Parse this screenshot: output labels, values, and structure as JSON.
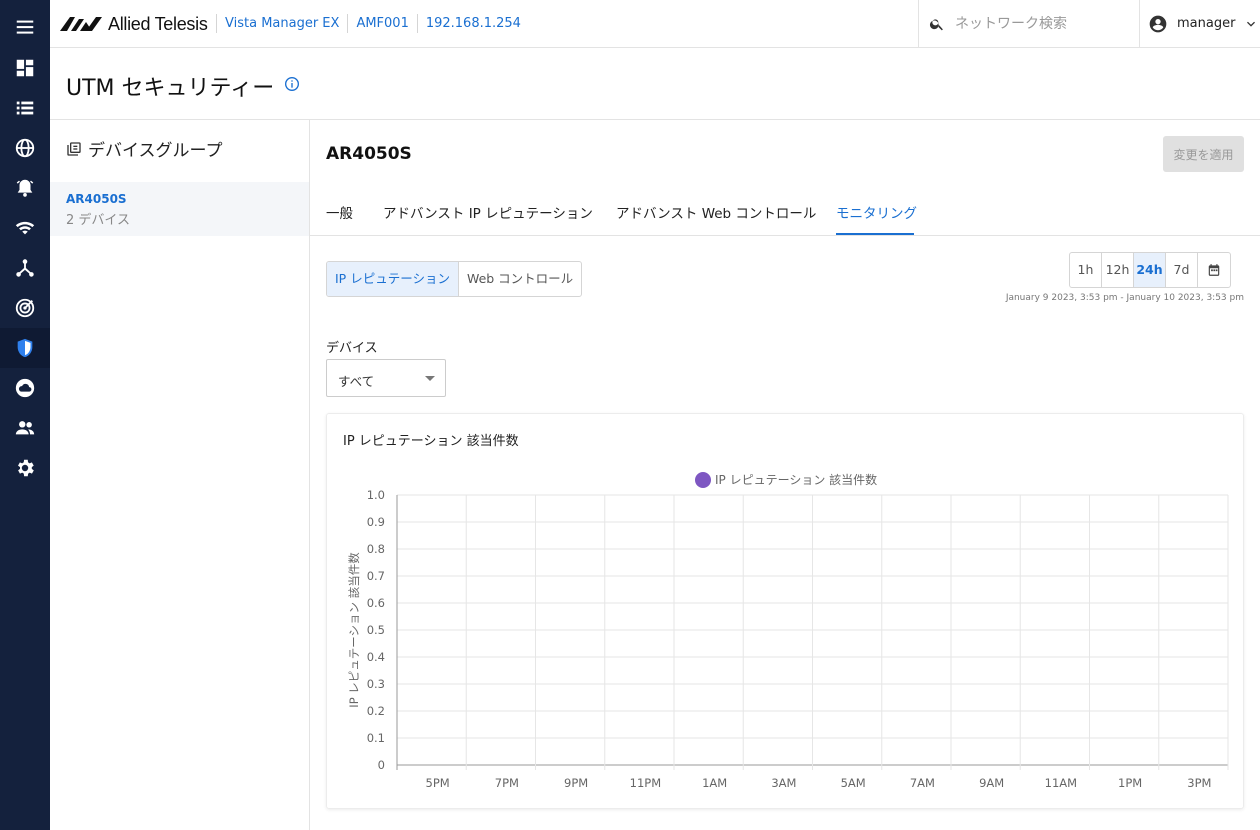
{
  "header": {
    "logo_text": "Allied Telesis",
    "breadcrumbs": [
      "Vista Manager EX",
      "AMF001",
      "192.168.1.254"
    ],
    "search_placeholder": "ネットワーク検索",
    "user_name": "manager"
  },
  "nav": {
    "icons": [
      "menu-icon",
      "dashboard-icon",
      "list-icon",
      "globe-icon",
      "alarm-icon",
      "wifi-icon",
      "network-topology-icon",
      "radar-icon",
      "security-shield-icon",
      "cloud-icon",
      "users-icon",
      "gear-icon"
    ],
    "active": "security-shield-icon"
  },
  "page": {
    "title": "UTM セキュリティー"
  },
  "group_panel": {
    "title": "デバイスグループ",
    "items": [
      {
        "name": "AR4050S",
        "sub": "2 デバイス"
      }
    ]
  },
  "main": {
    "device_title": "AR4050S",
    "apply_label": "変更を適用",
    "tabs": [
      "一般",
      "アドバンスト IP レピュテーション",
      "アドバンスト Web コントロール",
      "モニタリング"
    ],
    "active_tab": "モニタリング",
    "segments": [
      "IP レピュテーション",
      "Web コントロール"
    ],
    "active_segment": "IP レピュテーション",
    "ranges": [
      "1h",
      "12h",
      "24h",
      "7d"
    ],
    "active_range": "24h",
    "range_text": "January 9 2023, 3:53 pm - January 10 2023, 3:53 pm",
    "device_label": "デバイス",
    "device_value": "すべて"
  },
  "colors": {
    "accent": "#1a6fd1",
    "nav_bg": "#14213d",
    "series": "#7e57c2"
  },
  "chart_data": {
    "type": "line",
    "title": "IP レピュテーション 該当件数",
    "ylabel": "IP レピュテーション 該当件数",
    "xlabel": "",
    "x": [
      "5PM",
      "7PM",
      "9PM",
      "11PM",
      "1AM",
      "3AM",
      "5AM",
      "7AM",
      "9AM",
      "11AM",
      "1PM",
      "3PM"
    ],
    "yticks": [
      "1.0",
      "0.9",
      "0.8",
      "0.7",
      "0.6",
      "0.5",
      "0.4",
      "0.3",
      "0.2",
      "0.1",
      "0"
    ],
    "ylim": [
      0,
      1
    ],
    "series": [
      {
        "name": "IP レピュテーション 該当件数",
        "values": []
      }
    ],
    "legend": "top",
    "grid": true
  }
}
